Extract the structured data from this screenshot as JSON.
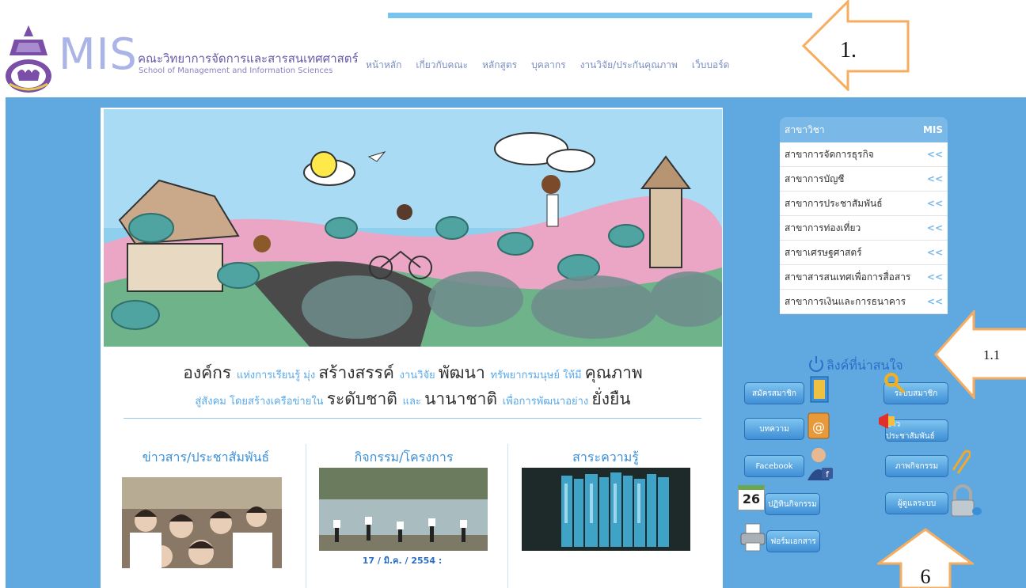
{
  "header": {
    "logo_mis": "MIS",
    "logo_thai": "คณะวิทยาการจัดการและสารสนเทศศาสตร์",
    "logo_english": "School of Management and Information Sciences",
    "nav": [
      "หน้าหลัก",
      "เกี่ยวกับคณะ",
      "หลักสูตร",
      "บุคลากร",
      "งานวิจัย/ประกันคุณภาพ",
      "เว็บบอร์ด"
    ]
  },
  "slogan": {
    "line1": [
      {
        "text": "องค์กร ",
        "style": "big"
      },
      {
        "text": "แห่งการเรียนรู้ มุ่ง ",
        "style": "small"
      },
      {
        "text": "สร้างสรรค์ ",
        "style": "big"
      },
      {
        "text": "งานวิจัย ",
        "style": "small"
      },
      {
        "text": "พัฒนา ",
        "style": "big"
      },
      {
        "text": "ทรัพยากรมนุษย์ ให้มี ",
        "style": "small"
      },
      {
        "text": "คุณภาพ",
        "style": "big"
      }
    ],
    "line2": [
      {
        "text": "สู่สังคม โดยสร้างเครือข่ายใน ",
        "style": "small"
      },
      {
        "text": "ระดับชาติ ",
        "style": "big"
      },
      {
        "text": "และ ",
        "style": "small"
      },
      {
        "text": "นานาชาติ ",
        "style": "big"
      },
      {
        "text": "เพื่อการพัฒนาอย่าง ",
        "style": "small"
      },
      {
        "text": "ยั่งยืน",
        "style": "big"
      }
    ]
  },
  "columns": {
    "news": {
      "title": "ข่าวสาร/ประชาสัมพันธ์"
    },
    "activities": {
      "title": "กิจกรรม/โครงการ",
      "date": "17 / มิ.ค. / 2554 :"
    },
    "knowledge": {
      "title": "สาระความรู้"
    }
  },
  "sidebar": {
    "header_label": "สาขาวิชา",
    "header_badge": "MIS",
    "chevron": "<<",
    "items": [
      "สาขาการจัดการธุรกิจ",
      "สาขาการบัญชี",
      "สาขาการประชาสัมพันธ์",
      "สาขาการท่องเที่ยว",
      "สาขาเศรษฐศาสตร์",
      "สาขาสารสนเทศเพื่อการสื่อสาร",
      "สาขาการเงินและการธนาคาร"
    ]
  },
  "links": {
    "title": "ลิงค์ที่น่าสนใจ",
    "calendar_day": "26",
    "buttons": {
      "register": "สมัครสมาชิก",
      "login": "ระบบสมาชิก",
      "article": "บทความ",
      "pr_news": "ข่าวประชาสัมพันธ์",
      "facebook": "Facebook",
      "activity_photos": "ภาพกิจกรรม",
      "activity_calendar": "ปฏิทินกิจกรรม",
      "admin": "ผู้ดูแลระบบ",
      "forms": "ฟอร์มเอกสาร"
    }
  },
  "annotations": {
    "arrow_1": "1.",
    "arrow_1_1": "1.1",
    "arrow_6": "6"
  },
  "colors": {
    "page_blue": "#5fa9e0",
    "accent_blue": "#3a8fd8",
    "arrow_orange": "#f6ad60",
    "sidebar_header": "#7ab8e8"
  }
}
